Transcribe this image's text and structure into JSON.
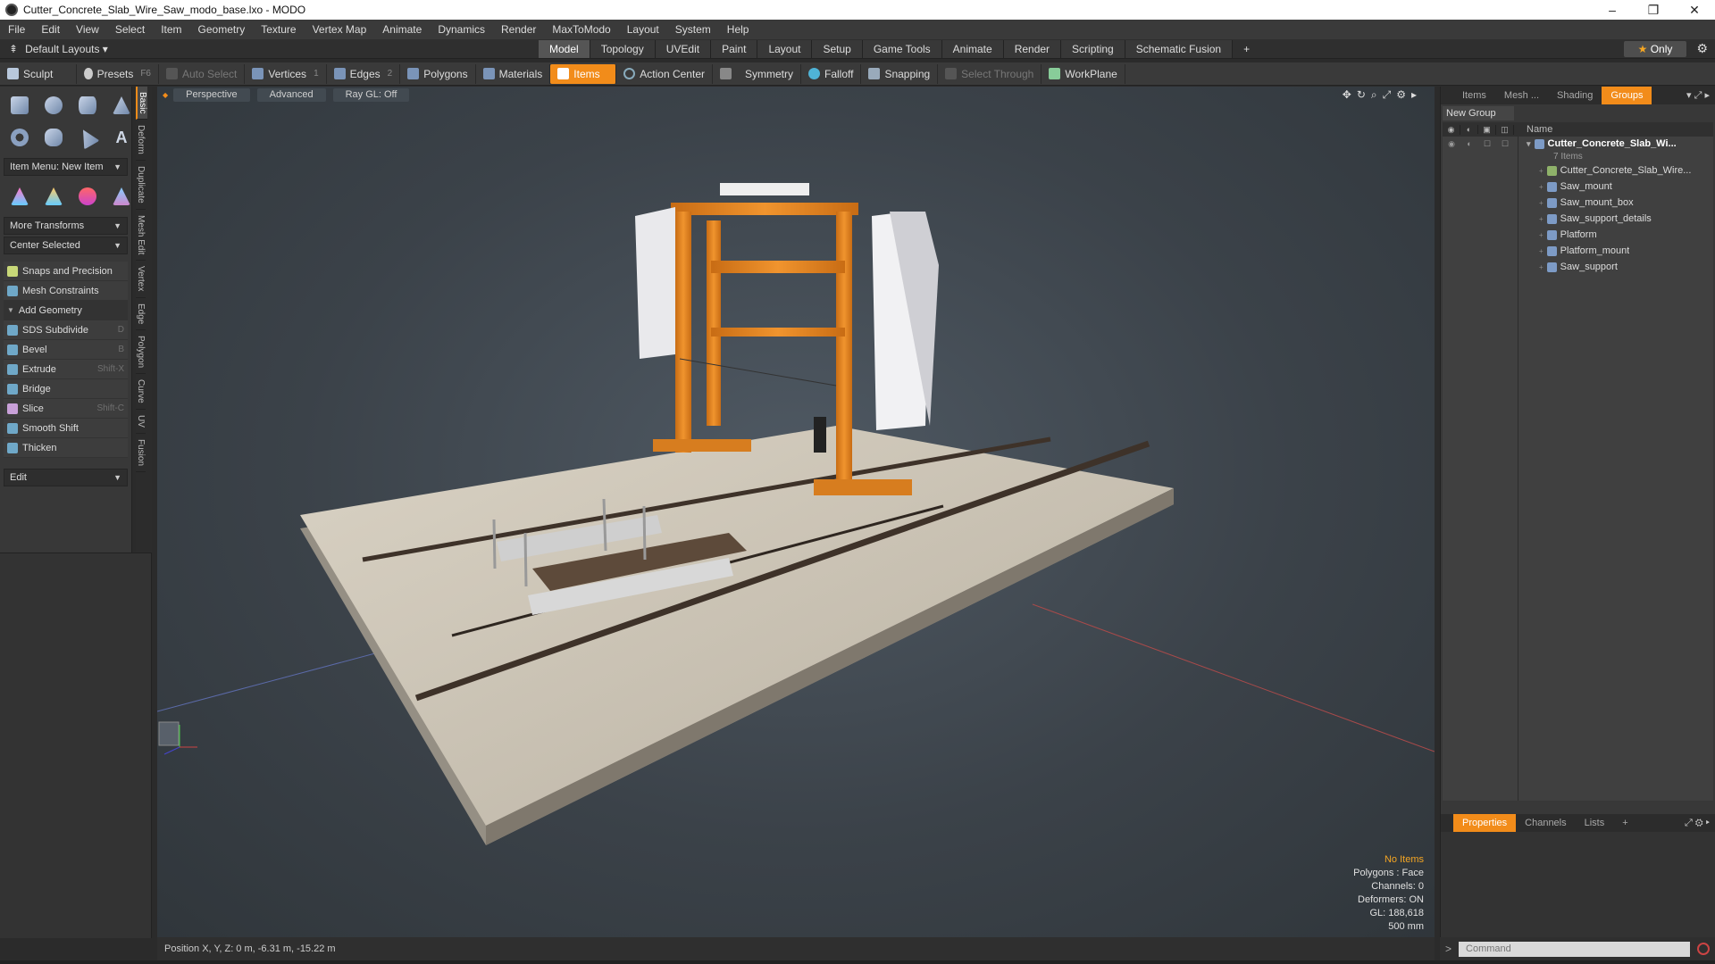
{
  "window": {
    "title": "Cutter_Concrete_Slab_Wire_Saw_modo_base.lxo - MODO"
  },
  "menu": [
    "File",
    "Edit",
    "View",
    "Select",
    "Item",
    "Geometry",
    "Texture",
    "Vertex Map",
    "Animate",
    "Dynamics",
    "Render",
    "MaxToModo",
    "Layout",
    "System",
    "Help"
  ],
  "layoutbar": {
    "layout_select": "Default Layouts ▾",
    "tabs": [
      "Model",
      "Topology",
      "UVEdit",
      "Paint",
      "Layout",
      "Setup",
      "Game Tools",
      "Animate",
      "Render",
      "Scripting",
      "Schematic Fusion"
    ],
    "active_tab": "Model",
    "plus": "+",
    "only_label": "Only",
    "only_star": "★"
  },
  "toolbar": {
    "sculpt": "Sculpt",
    "presets": "Presets",
    "presets_key": "F6",
    "auto_select": "Auto Select",
    "vertices": "Vertices",
    "vertices_num": "1",
    "edges": "Edges",
    "edges_num": "2",
    "polygons": "Polygons",
    "materials": "Materials",
    "items": "Items",
    "action_center": "Action Center",
    "symmetry": "Symmetry",
    "falloff": "Falloff",
    "snapping": "Snapping",
    "select_through": "Select Through",
    "workplane": "WorkPlane"
  },
  "left": {
    "item_menu": "Item Menu: New Item",
    "more_transforms": "More Transforms",
    "center_selected": "Center Selected",
    "snaps": "Snaps and Precision",
    "mesh_constraints": "Mesh Constraints",
    "add_geometry": "Add Geometry",
    "tools": [
      {
        "label": "SDS Subdivide",
        "key": "D"
      },
      {
        "label": "Bevel",
        "key": "B"
      },
      {
        "label": "Extrude",
        "key": "Shift-X"
      },
      {
        "label": "Bridge",
        "key": ""
      },
      {
        "label": "Slice",
        "key": "Shift-C"
      },
      {
        "label": "Smooth Shift",
        "key": ""
      },
      {
        "label": "Thicken",
        "key": ""
      }
    ],
    "edit": "Edit",
    "vtabs": [
      "Basic",
      "Deform",
      "Duplicate",
      "Mesh Edit",
      "Vertex",
      "Edge",
      "Polygon",
      "Curve",
      "UV",
      "Fusion"
    ]
  },
  "viewport": {
    "perspective": "Perspective",
    "advanced": "Advanced",
    "raygl": "Ray GL: Off",
    "info": {
      "no_items": "No Items",
      "polygons": "Polygons : Face",
      "channels": "Channels: 0",
      "deformers": "Deformers: ON",
      "gl": "GL: 188,618",
      "scale": "500 mm"
    }
  },
  "status": {
    "position": "Position X, Y, Z:  0 m, -6.31 m, -15.22 m"
  },
  "right": {
    "tabs": [
      "Items",
      "Mesh ...",
      "Shading",
      "Groups"
    ],
    "active_tab": "Groups",
    "new_group": "New Group",
    "name_col": "Name",
    "root": "Cutter_Concrete_Slab_Wi...",
    "root_sub": "7 Items",
    "items": [
      "Cutter_Concrete_Slab_Wire...",
      "Saw_mount",
      "Saw_mount_box",
      "Saw_support_details",
      "Platform",
      "Platform_mount",
      "Saw_support"
    ],
    "prop_tabs": [
      "Properties",
      "Channels",
      "Lists"
    ],
    "prop_active": "Properties",
    "command_placeholder": "Command"
  },
  "colors": {
    "accent": "#f28c1a",
    "saw_orange": "#e8892a",
    "concrete": "#cfc7b8",
    "rail": "#4a3a2e"
  }
}
